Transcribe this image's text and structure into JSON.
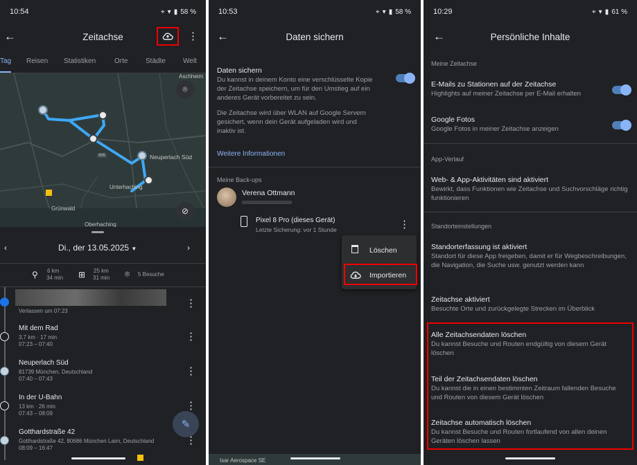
{
  "p1": {
    "time": "10:54",
    "battery": "58 %",
    "title": "Zeitachse",
    "tabs": [
      "Tag",
      "Reisen",
      "Statistiken",
      "Orte",
      "Städte",
      "Welt"
    ],
    "map": {
      "labels": [
        "Aschheim",
        "Neuperlach Süd",
        "Unterhaching",
        "Grünwald",
        "Oberhaching"
      ],
      "road": "995"
    },
    "date": "Di., der 13.05.2025",
    "summary": {
      "bike": [
        "6 km",
        "34 min"
      ],
      "transit": [
        "25 km",
        "31 min"
      ],
      "visits": "5 Besuche"
    },
    "timeline": [
      {
        "title": "",
        "sub1": "Verlassen um 07:23",
        "sub2": ""
      },
      {
        "title": "Mit dem Rad",
        "sub1": "3,7 km · 17 min",
        "sub2": "07:23 – 07:40"
      },
      {
        "title": "Neuperlach Süd",
        "sub1": "81739 München, Deutschland",
        "sub2": "07:40 – 07:43"
      },
      {
        "title": "In der U-Bahn",
        "sub1": "13 km · 26 min",
        "sub2": "07:43 – 08:09"
      },
      {
        "title": "Gotthardstraße 42",
        "sub1": "Gotthardstraße 42, 80686 München Laim, Deutschland",
        "sub2": "08:09 – 16:47"
      }
    ]
  },
  "p2": {
    "time": "10:53",
    "battery": "58 %",
    "title": "Daten sichern",
    "backup_title": "Daten sichern",
    "backup_desc": "Du kannst in deinem Konto eine verschlüsselte Kopie der Zeitachse speichern, um für den Umstieg auf ein anderes Gerät vorbereitet zu sein.",
    "backup_desc2": "Die Zeitachse wird über WLAN auf Google Servern gesichert, wenn dein Gerät aufgeladen wird und inaktiv ist.",
    "more_info": "Weitere Informationen",
    "my_backups": "Meine Back-ups",
    "account_name": "Verena Ottmann",
    "device": "Pixel 8 Pro (dieses Gerät)",
    "last_backup": "Letzte Sicherung: vor 1 Stunde",
    "menu": [
      "Löschen",
      "Importieren"
    ],
    "bottom_label": "Isar Aerospace SE"
  },
  "p3": {
    "time": "10:29",
    "battery": "61 %",
    "title": "Persönliche Inhalte",
    "sec1": "Meine Zeitachse",
    "items1": [
      {
        "title": "E-Mails zu Stationen auf der Zeitachse",
        "desc": "Highlights auf meiner Zeitachse per E-Mail erhalten"
      },
      {
        "title": "Google Fotos",
        "desc": "Google Fotos in meiner Zeitachse anzeigen"
      }
    ],
    "sec2": "App-Verlauf",
    "web_title": "Web- & App-Aktivitäten sind aktiviert",
    "web_desc": "Bewirkt, dass Funktionen wie Zeitachse und Suchvorschläge richtig funktionieren",
    "sec3": "Standorteinstellungen",
    "loc_title": "Standorterfassung ist aktiviert",
    "loc_desc": "Standort für diese App freigeben, damit er für Wegbeschreibungen, die Navigation, die Suche usw. genutzt werden kann",
    "tl_title": "Zeitachse aktiviert",
    "tl_desc": "Besuchte Orte und zurückgelegte Strecken im Überblick",
    "delete_items": [
      {
        "title": "Alle Zeitachsendaten löschen",
        "desc": "Du kannst Besuche und Routen endgültig von diesem Gerät löschen"
      },
      {
        "title": "Teil der Zeitachsendaten löschen",
        "desc": "Du kannst die in einen bestimmten Zeitraum fallenden Besuche und Routen von diesem Gerät löschen"
      },
      {
        "title": "Zeitachse automatisch löschen",
        "desc": "Du kannst Besuche und Routen fortlaufend von allen deinen Geräten löschen lassen"
      }
    ]
  },
  "colors": {
    "bg": "#202124",
    "accent": "#8ab4f8",
    "highlight": "#e00000",
    "route": "#3ea8f5"
  }
}
